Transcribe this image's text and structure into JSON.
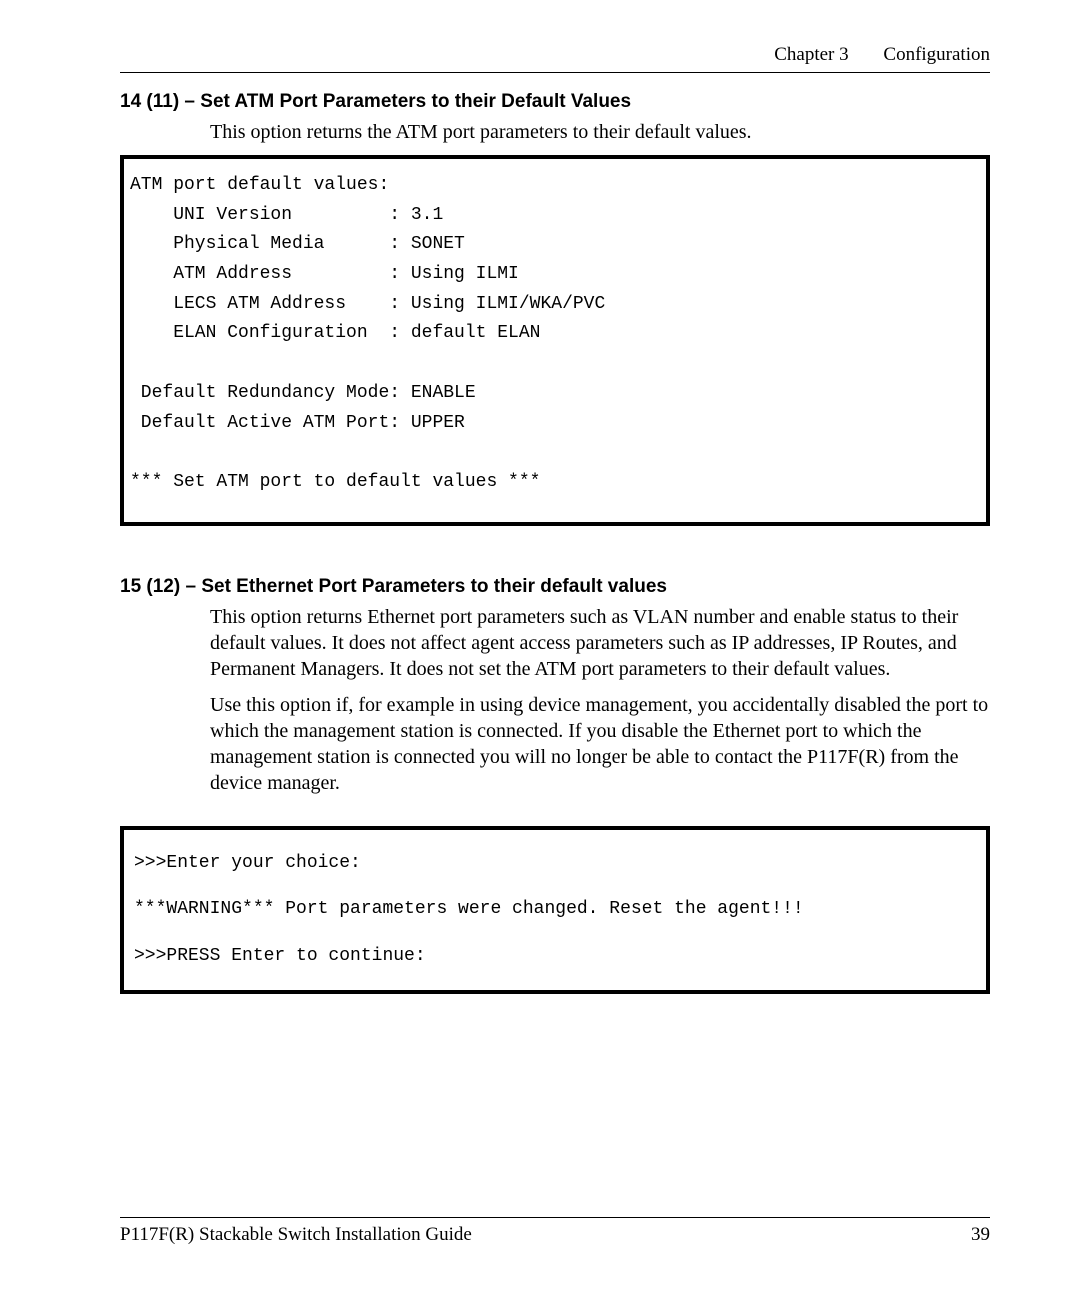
{
  "header": {
    "chapter": "Chapter 3",
    "title": "Configuration"
  },
  "section1": {
    "heading": "14 (11) – Set ATM Port Parameters to their Default Values",
    "intro": "This option returns the ATM port parameters to their default values.",
    "terminal": "ATM port default values:\n    UNI Version         : 3.1\n    Physical Media      : SONET\n    ATM Address         : Using ILMI\n    LECS ATM Address    : Using ILMI/WKA/PVC\n    ELAN Configuration  : default ELAN\n\n Default Redundancy Mode: ENABLE\n Default Active ATM Port: UPPER\n\n*** Set ATM port to default values ***"
  },
  "section2": {
    "heading": "15 (12) – Set Ethernet Port Parameters to their default values",
    "para1": "This option returns Ethernet port parameters such as VLAN number and enable status to their default values. It does not affect agent access parameters such as IP addresses, IP Routes, and Permanent Managers. It does not set the ATM port parameters to their default values.",
    "para2": "Use this option if, for example in using device management, you accidentally disabled the port to which the management station is connected. If you disable the Ethernet port to which the management station is connected you will no longer be able to contact the P117F(R) from the device manager.",
    "terminal": ">>>Enter your choice:\n***WARNING*** Port parameters were changed. Reset the agent!!!\n>>>PRESS Enter to continue:"
  },
  "footer": {
    "left": "P117F(R) Stackable Switch Installation Guide",
    "right": "39"
  }
}
